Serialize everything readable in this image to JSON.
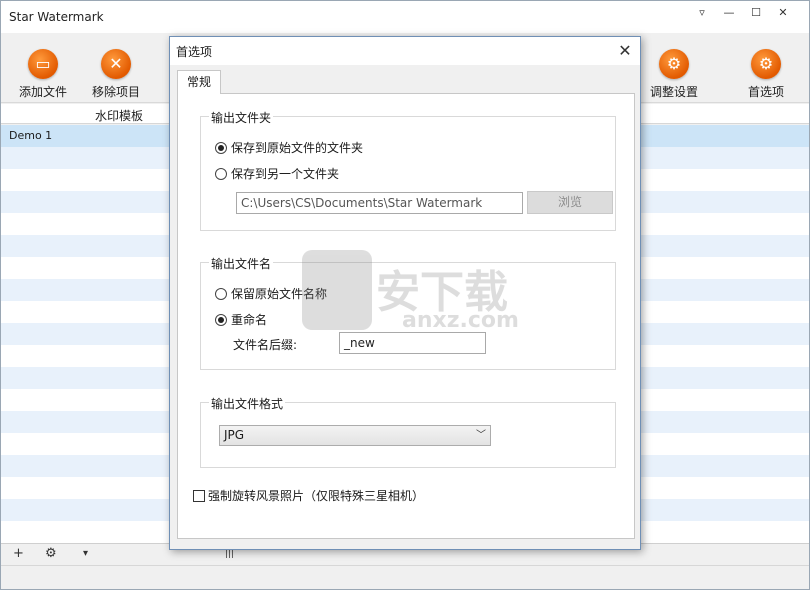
{
  "app": {
    "title": "Star Watermark",
    "window_controls": {
      "menu": "▿",
      "minimize": "—",
      "maximize": "☐",
      "close": "✕"
    }
  },
  "toolbar": {
    "add_files": "添加文件",
    "remove_item": "移除项目",
    "adjust_settings": "调整设置",
    "preferences": "首选项"
  },
  "list": {
    "header": "水印模板",
    "items": [
      "Demo 1"
    ]
  },
  "bottombar": {
    "add": "+",
    "gear": "⚙",
    "dropdown": "▾",
    "grip": "|||"
  },
  "dialog": {
    "title": "首选项",
    "close": "✕",
    "tab": "常规",
    "output_folder": {
      "legend": "输出文件夹",
      "save_original": "保存到原始文件的文件夹",
      "save_other": "保存到另一个文件夹",
      "selected": "save_original",
      "path": "C:\\Users\\CS\\Documents\\Star Watermark",
      "browse": "浏览"
    },
    "output_filename": {
      "legend": "输出文件名",
      "keep_original": "保留原始文件名称",
      "rename": "重命名",
      "selected": "rename",
      "suffix_label": "文件名后缀:",
      "suffix_value": "_new"
    },
    "output_format": {
      "legend": "输出文件格式",
      "value": "JPG"
    },
    "force_rotate": {
      "label": "强制旋转风景照片（仅限特殊三星相机）",
      "checked": false
    }
  },
  "watermark_overlay": {
    "big": "安下载",
    "small": "anxz.com"
  }
}
